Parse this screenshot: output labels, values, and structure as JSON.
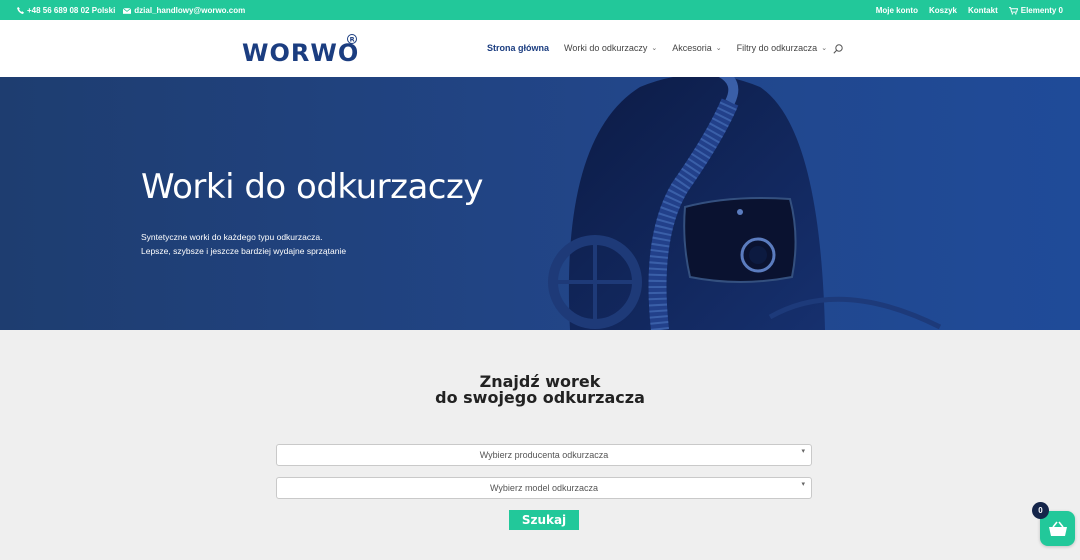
{
  "topbar": {
    "phone": "+48 56 689 08 02 Polski",
    "email": "dzial_handlowy@worwo.com",
    "account": "Moje konto",
    "cart": "Koszyk",
    "contact": "Kontakt",
    "items": "Elementy 0"
  },
  "header": {
    "logo_text": "WORWO",
    "nav": [
      {
        "label": "Strona główna"
      },
      {
        "label": "Worki do odkurzaczy"
      },
      {
        "label": "Akcesoria"
      },
      {
        "label": "Filtry do odkurzacza"
      }
    ]
  },
  "hero": {
    "title": "Worki do odkurzaczy",
    "subtitle_line1": "Syntetyczne worki do każdego typu odkurzacza.",
    "subtitle_line2": "Lepsze, szybsze i jeszcze bardziej wydajne sprzątanie"
  },
  "finder": {
    "title_line1": "Znajdź worek",
    "title_line2": "do swojego odkurzacza",
    "manufacturer_placeholder": "Wybierz producenta odkurzacza",
    "model_placeholder": "Wybierz model odkurzacza",
    "search_label": "Szukaj"
  },
  "cart_widget": {
    "count": "0"
  },
  "colors": {
    "accent": "#22c89a",
    "brand_navy": "#1b3d80",
    "hero_blue": "#22468a"
  }
}
